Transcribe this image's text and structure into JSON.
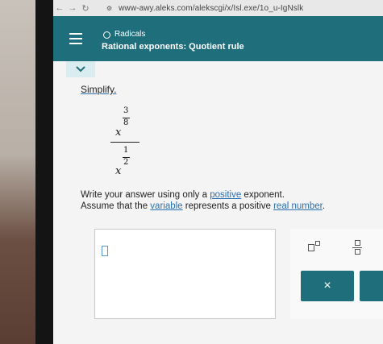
{
  "browser": {
    "back_icon": "←",
    "forward_icon": "→",
    "reload_icon": "↻",
    "site_icon": "⚙",
    "url": "www-awy.aleks.com/alekscgi/x/Isl.exe/1o_u-IgNslk"
  },
  "header": {
    "topic": "Radicals",
    "subtopic": "Rational exponents: Quotient rule"
  },
  "problem": {
    "prompt": "Simplify.",
    "numerator": {
      "base": "x",
      "exp_num": "3",
      "exp_den": "8"
    },
    "denominator": {
      "base": "x",
      "exp_num": "1",
      "exp_den": "2"
    },
    "instruction1_a": "Write your answer using only a ",
    "instruction1_link": "positive",
    "instruction1_b": " exponent.",
    "instruction2_a": "Assume that the ",
    "instruction2_link1": "variable",
    "instruction2_b": " represents a positive ",
    "instruction2_link2": "real number",
    "instruction2_c": "."
  },
  "tools": {
    "clear_label": "×"
  },
  "colors": {
    "header": "#1f6e7c",
    "link": "#2a6fb0"
  }
}
